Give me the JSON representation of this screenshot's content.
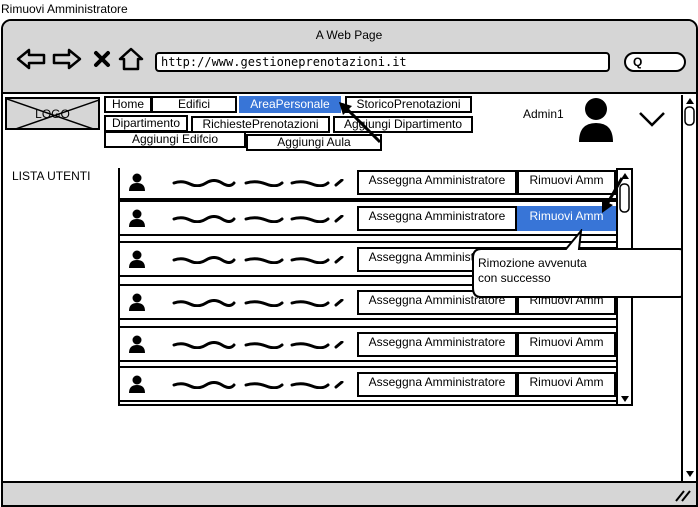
{
  "page_caption": "Rimuovi Amministratore",
  "window_title": "A Web Page",
  "address_bar": {
    "url": "http://www.gestioneprenotazioni.it",
    "search_glyph": "Q"
  },
  "logo": "LOGO",
  "nav": {
    "home": "Home",
    "edifici": "Edifici",
    "area_personale": "AreaPersonale",
    "storico": "StoricoPrenotazioni",
    "dipartimento": "Dipartimento",
    "richieste": "RichiestePrenotazioni",
    "aggiungi_dipartimento": "Aggiungi Dipartimento",
    "aggiungi_edificio": "Aggiungi Edifcio",
    "aggiungi_aula": "Aggiungi Aula"
  },
  "user": {
    "name": "Admin1"
  },
  "list": {
    "title": "LISTA UTENTI",
    "rows": [
      {
        "assign": "Asseggna Amministratore",
        "remove": "Rimuovi Amm",
        "remove_active": false
      },
      {
        "assign": "Asseggna Amministratore",
        "remove": "Rimuovi Amm",
        "remove_active": true
      },
      {
        "assign": "Asseggna Amministratore",
        "remove": "Rimuovi Amm",
        "remove_active": false
      },
      {
        "assign": "Asseggna Amministratore",
        "remove": "Rimuovi Amm",
        "remove_active": false
      },
      {
        "assign": "Asseggna Amministratore",
        "remove": "Rimuovi Amm",
        "remove_active": false
      },
      {
        "assign": "Asseggna Amministratore",
        "remove": "Rimuovi Amm",
        "remove_active": false
      }
    ]
  },
  "tooltip": {
    "line1": "Rimozione avvenuta",
    "line2": "con successo"
  },
  "colors": {
    "accent": "#3875d7",
    "chrome": "#d6d6d6"
  }
}
